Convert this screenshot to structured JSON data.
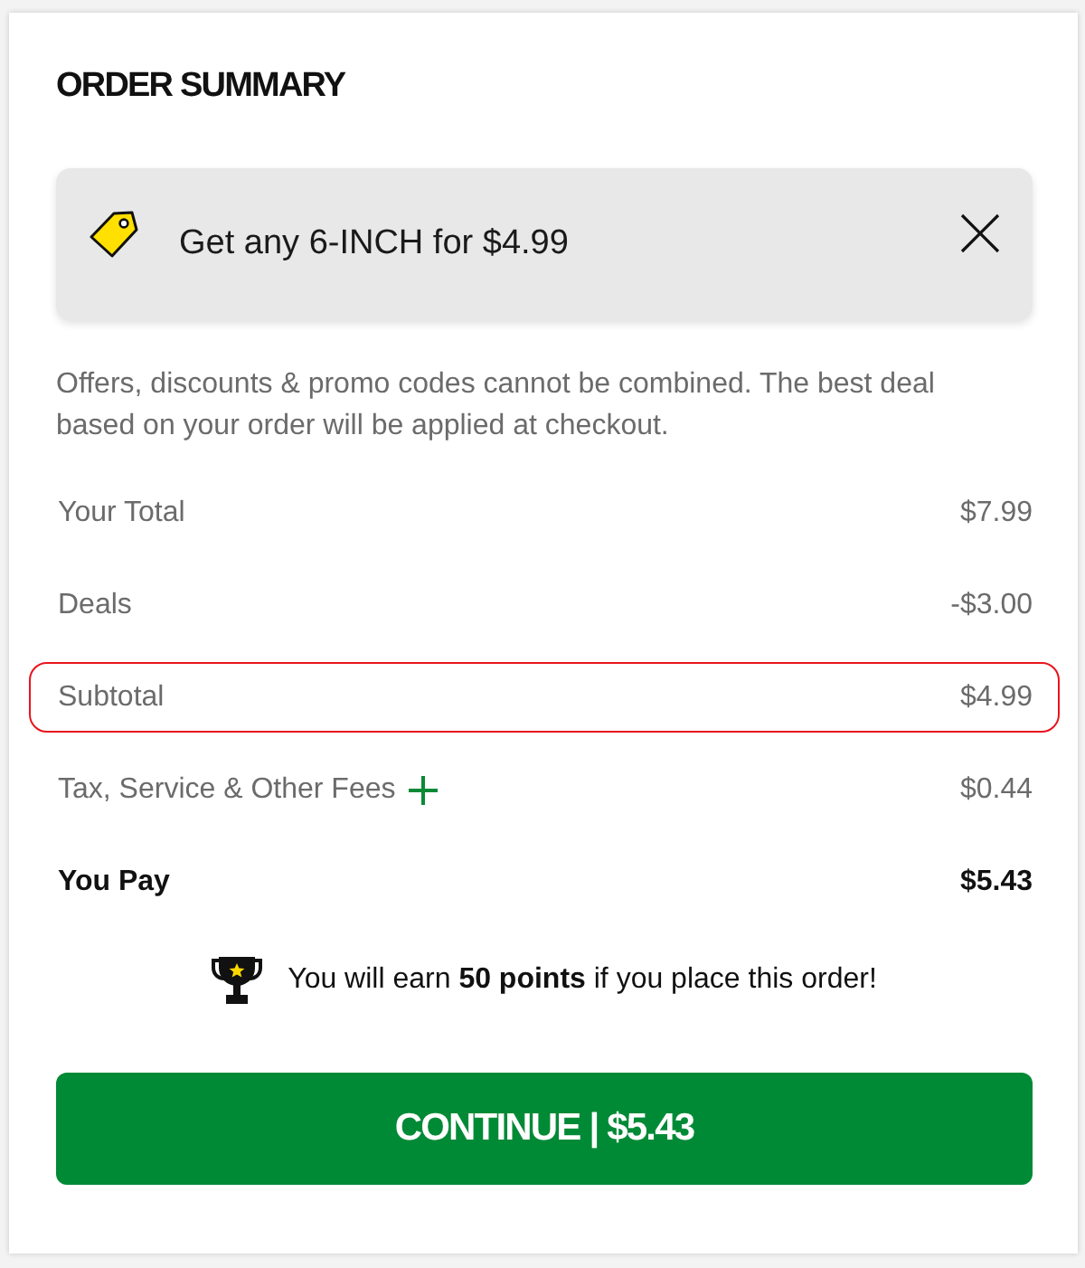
{
  "title": "ORDER SUMMARY",
  "promo": {
    "text": "Get any 6-INCH for $4.99"
  },
  "disclaimer": "Offers, discounts & promo codes cannot be combined. The best deal based on your order will be applied at checkout.",
  "rows": [
    {
      "kind": "line",
      "label": "Your Total",
      "value": "$7.99",
      "highlighted": false
    },
    {
      "kind": "line",
      "label": "Deals",
      "value": "-$3.00",
      "highlighted": false
    },
    {
      "kind": "line",
      "label": "Subtotal",
      "value": "$4.99",
      "highlighted": true
    },
    {
      "kind": "fees",
      "label": "Tax, Service & Other Fees",
      "value": "$0.44",
      "highlighted": false
    },
    {
      "kind": "total",
      "label": "You Pay",
      "value": "$5.43",
      "highlighted": false
    }
  ],
  "rewards": {
    "message": "You will earn **50 points** if you place this order!"
  },
  "continue_button": {
    "label": "CONTINUE | $5.43"
  }
}
